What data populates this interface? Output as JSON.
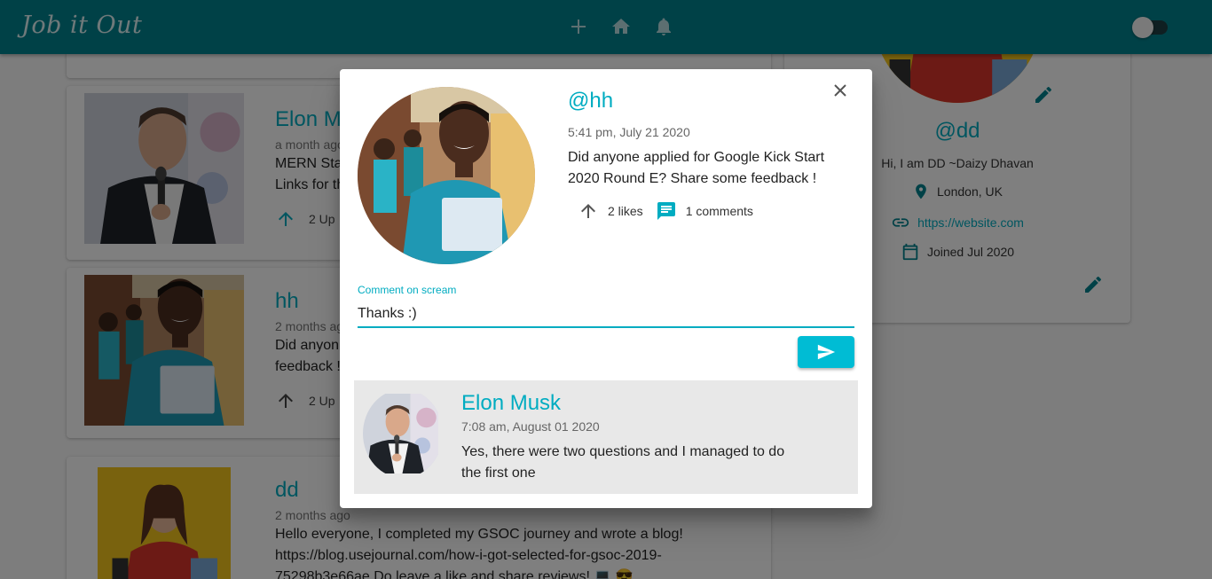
{
  "app": {
    "brand": "Job it Out"
  },
  "feed": {
    "posts": [
      {
        "handle": "Elon M",
        "time": "a month ago",
        "text": "MERN Sta\nLinks for th",
        "upvotes": "2 Up"
      },
      {
        "handle": "hh",
        "time": "2 months ag",
        "text": "Did anyon\nfeedback !",
        "upvotes": "2 Up"
      },
      {
        "handle": "dd",
        "time": "2 months ago",
        "text": "Hello everyone, I completed my GSOC journey and wrote a blog!\nhttps://blog.usejournal.com/how-i-got-selected-for-gsoc-2019-\n75298b3e66ae Do leave a like and share reviews! 💻 😎"
      }
    ]
  },
  "profile": {
    "handle": "@dd",
    "bio": "Hi, I am DD ~Daizy Dhavan",
    "location": "London, UK",
    "website": "https://website.com",
    "joined": "Joined Jul 2020"
  },
  "dialog": {
    "handle": "@hh",
    "time": "5:41 pm, July 21 2020",
    "body": "Did anyone applied for Google Kick Start 2020 Round E? Share some feedback !",
    "likes": "2 likes",
    "comments": "1 comments",
    "comment_label": "Comment on scream",
    "comment_value": "Thanks :)",
    "comment_list": [
      {
        "name": "Elon Musk",
        "time": "7:08 am, August 01 2020",
        "body": "Yes, there were two questions and I managed to do the first one"
      }
    ]
  },
  "colors": {
    "appbar": "#00838f",
    "accent": "#00acc1",
    "send": "#00bcd4"
  },
  "icons": [
    "add-icon",
    "home-icon",
    "bell-icon",
    "close-icon",
    "upvote-icon",
    "chat-icon",
    "send-icon",
    "location-icon",
    "link-icon",
    "calendar-icon",
    "edit-icon"
  ]
}
